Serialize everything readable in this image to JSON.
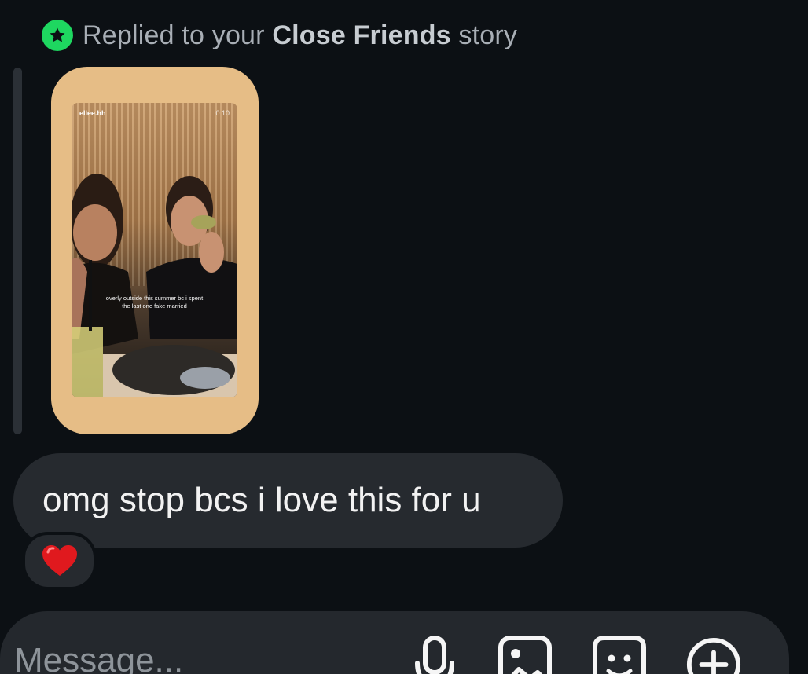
{
  "reply_header": {
    "prefix": "Replied to your ",
    "highlight": "Close Friends",
    "suffix": " story",
    "icon": "close-friends-star-icon",
    "icon_color": "#1ed760"
  },
  "story": {
    "username": "ellee.hh",
    "timestamp": "0:10",
    "caption": "overly outside this summer bc i spent the last one fake married",
    "card_color": "#e6bd86"
  },
  "message": {
    "text": "omg stop bcs i love this for u",
    "reaction": "heart-emoji"
  },
  "composer": {
    "placeholder": "Message...",
    "buttons": [
      "microphone-icon",
      "gallery-icon",
      "sticker-icon",
      "plus-icon"
    ]
  },
  "colors": {
    "background": "#0c1014",
    "bubble": "#262a2f",
    "accent_green": "#1ed760",
    "heart": "#e0191e"
  }
}
